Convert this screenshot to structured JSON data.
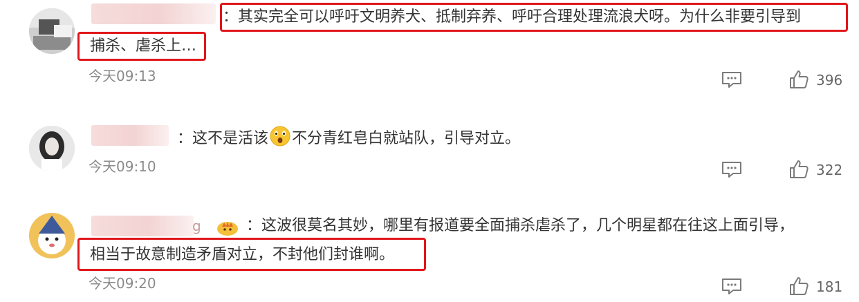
{
  "comments": [
    {
      "username_suffix": "",
      "lines": [
        "：其实完全可以呼吁文明养犬、抵制弃养、呼吁合理处理流浪犬呀。为什么非要引导到",
        "捕杀、虐杀上…"
      ],
      "timestamp": "今天09:13",
      "likes": "396"
    },
    {
      "username_suffix": "",
      "lines": [
        "：这不是活该",
        "不分青红皂白就站队，引导对立。"
      ],
      "timestamp": "今天09:10",
      "likes": "322"
    },
    {
      "username_suffix": "g",
      "lines": [
        "：这波很莫名其妙，哪里有报道要全面捕杀虐杀了，几个明星都在往这上面引导，",
        "相当于故意制造矛盾对立，不封他们封谁啊。"
      ],
      "timestamp": "今天09:20",
      "likes": "181"
    }
  ],
  "icons": {
    "reply": "comment-bubble-icon",
    "like": "thumbs-up-icon",
    "emoji_c2": "surprised-face-emoji",
    "badge_c3": "crown-badge-icon"
  },
  "colors": {
    "highlight": "#e0161b",
    "timestamp": "#8a8a8a",
    "text": "#333333"
  }
}
